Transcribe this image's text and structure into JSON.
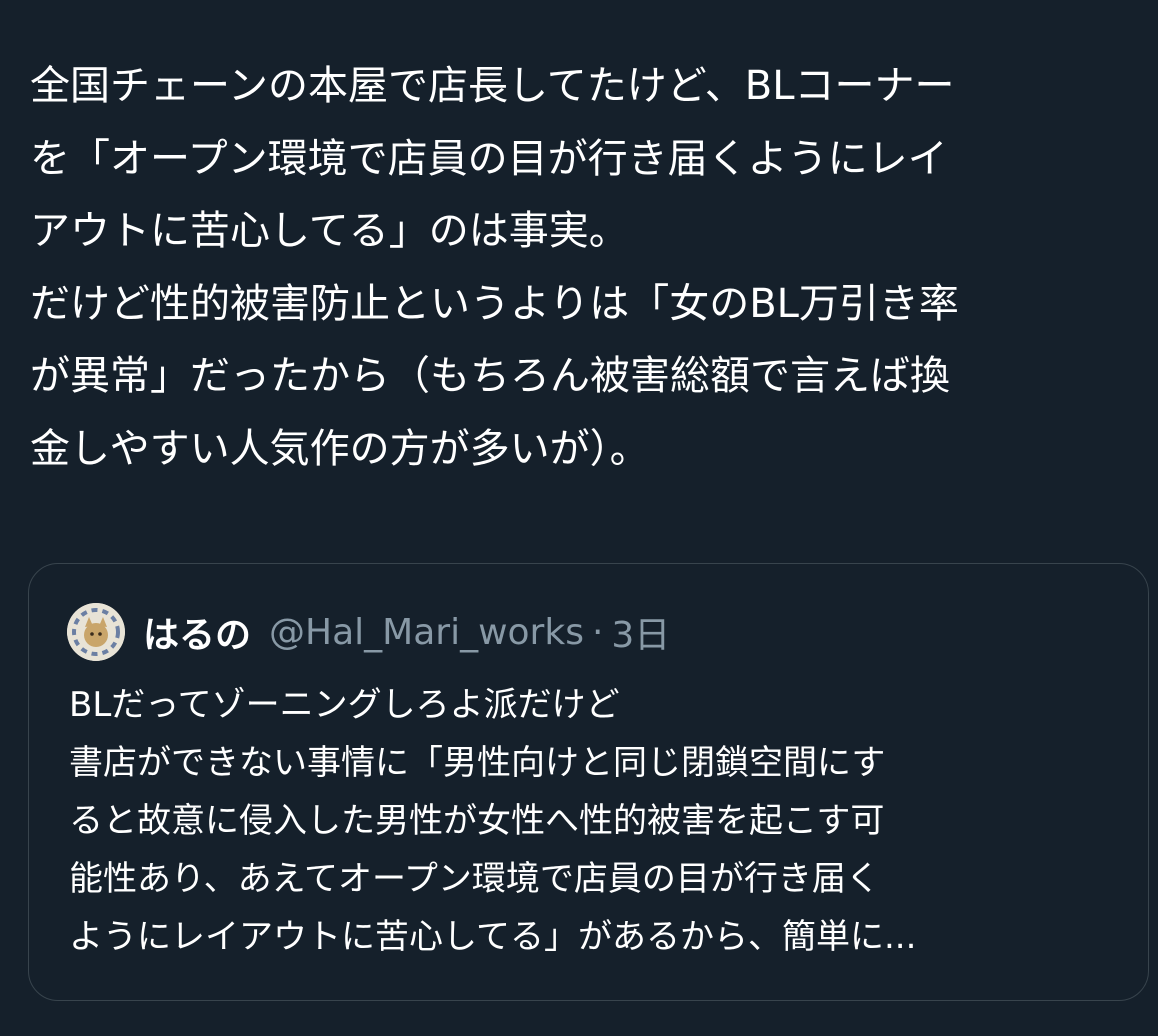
{
  "tweet": {
    "lines": [
      "全国チェーンの本屋で店長してたけど、BLコーナー",
      "を「オープン環境で店員の目が行き届くようにレイ",
      "アウトに苦心してる」のは事実。",
      "だけど性的被害防止というよりは「女のBL万引き率",
      "が異常」だったから（もちろん被害総額で言えば換",
      "金しやすい人気作の方が多いが）。"
    ]
  },
  "quote": {
    "name": "はるの",
    "handle": "@Hal_Mari_works",
    "separator": "·",
    "time": "3日",
    "lines": [
      "BLだってゾーニングしろよ派だけど",
      "書店ができない事情に「男性向けと同じ閉鎖空間にす",
      "ると故意に侵入した男性が女性へ性的被害を起こす可",
      "能性あり、あえてオープン環境で店員の目が行き届く",
      "ようにレイアウトに苦心してる」があるから、簡単に..."
    ]
  },
  "colors": {
    "background": "#15202b",
    "text": "#ffffff",
    "secondary_text": "#8899a6",
    "border": "#38444d"
  }
}
